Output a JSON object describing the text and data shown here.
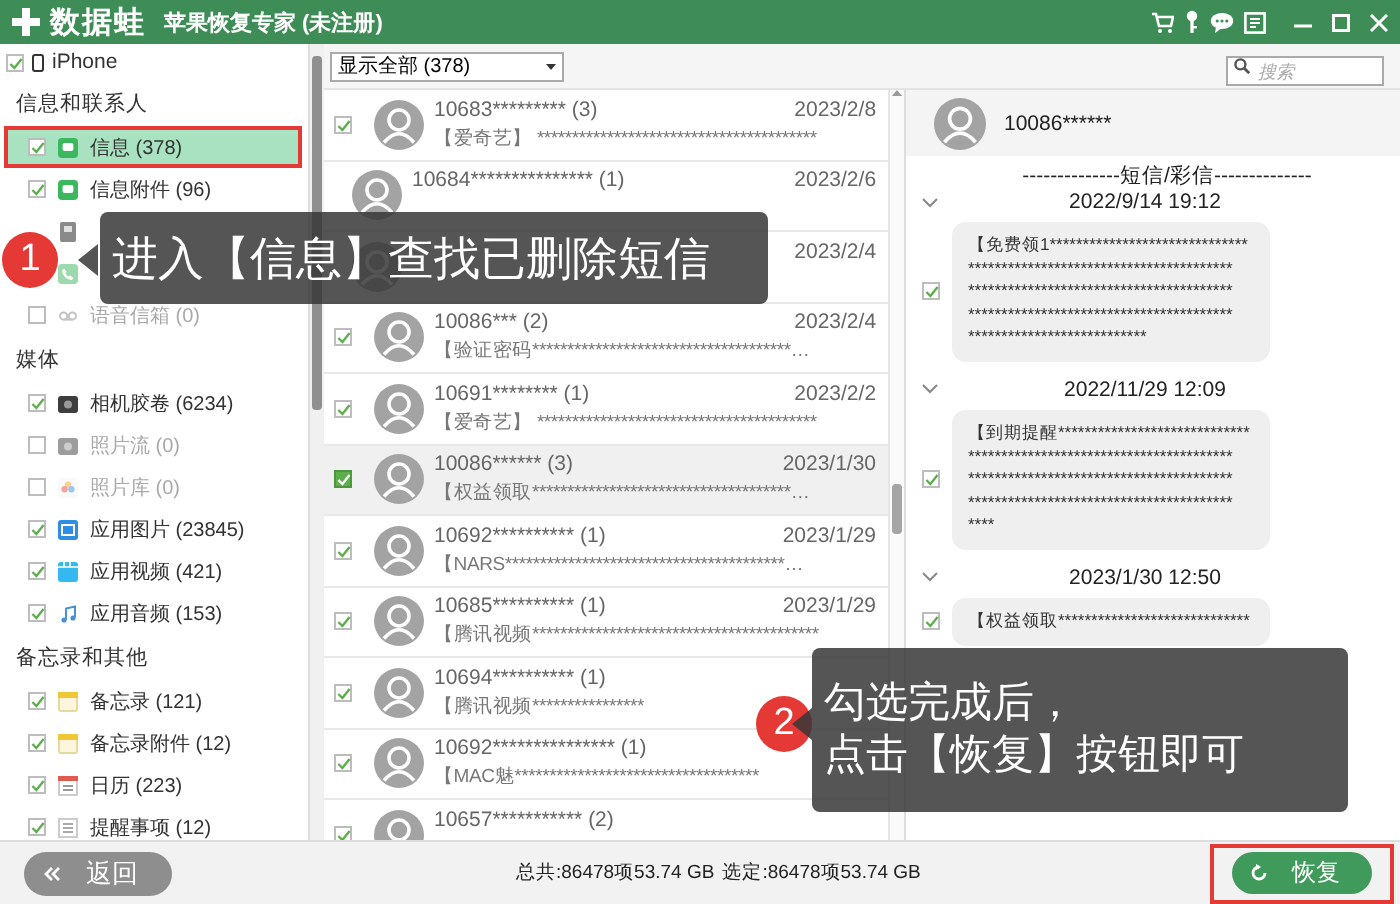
{
  "titlebar": {
    "logo": "数据蛙",
    "title": "苹果恢复专家 (未注册)"
  },
  "device": {
    "name": "iPhone",
    "checked": true
  },
  "sidebar": {
    "groups": [
      {
        "title": "信息和联系人",
        "items": [
          {
            "kind": "chat",
            "label": "信息 (378)",
            "checked": true,
            "disabled": false,
            "selected": true,
            "highlighted": true
          },
          {
            "kind": "chat",
            "label": "信息附件 (96)",
            "checked": true,
            "disabled": false,
            "selected": false,
            "highlighted": false
          },
          {
            "kind": "contacts",
            "disabled": false,
            "selected": false,
            "highlighted": false
          },
          {
            "kind": "phone",
            "disabled": true,
            "selected": false,
            "highlighted": false
          },
          {
            "kind": "voicemail",
            "label": "语音信箱 (0)",
            "checked": false,
            "disabled": true,
            "selected": false,
            "highlighted": false
          }
        ]
      },
      {
        "title": "媒体",
        "items": [
          {
            "kind": "camera",
            "label": "相机胶卷 (6234)",
            "checked": true,
            "disabled": false,
            "selected": false,
            "highlighted": false
          },
          {
            "kind": "camera",
            "label": "照片流 (0)",
            "checked": false,
            "disabled": true,
            "selected": false,
            "highlighted": false
          },
          {
            "kind": "flower",
            "label": "照片库 (0)",
            "checked": false,
            "disabled": true,
            "selected": false,
            "highlighted": false
          },
          {
            "kind": "image",
            "label": "应用图片 (23845)",
            "checked": true,
            "disabled": false,
            "selected": false,
            "highlighted": false
          },
          {
            "kind": "video",
            "label": "应用视频 (421)",
            "checked": true,
            "disabled": false,
            "selected": false,
            "highlighted": false
          },
          {
            "kind": "audio",
            "label": "应用音频 (153)",
            "checked": true,
            "disabled": false,
            "selected": false,
            "highlighted": false
          }
        ]
      },
      {
        "title": "备忘录和其他",
        "items": [
          {
            "kind": "note",
            "label": "备忘录 (121)",
            "checked": true,
            "disabled": false,
            "selected": false,
            "highlighted": false
          },
          {
            "kind": "note",
            "label": "备忘录附件 (12)",
            "checked": true,
            "disabled": false,
            "selected": false,
            "highlighted": false
          },
          {
            "kind": "calendar",
            "label": "日历 (223)",
            "checked": true,
            "disabled": false,
            "selected": false,
            "highlighted": false
          },
          {
            "kind": "list",
            "label": "提醒事项 (12)",
            "checked": true,
            "disabled": false,
            "selected": false,
            "highlighted": false
          }
        ]
      }
    ]
  },
  "toolbar": {
    "filter": "显示全部 (378)",
    "search": {
      "placeholder": "搜索"
    }
  },
  "messages": {
    "rows": [
      {
        "name": "10683********* (3)",
        "date": "2023/2/8",
        "preview": "【爱奇艺】 ****************************************",
        "checked": true,
        "selected": false
      },
      {
        "name": "10684*************** (1)",
        "date": "2023/2/6",
        "selected": false
      },
      {
        "date": "2023/2/4",
        "selected": false
      },
      {
        "name": "10086*** (2)",
        "date": "2023/2/4",
        "preview": "【验证密码*************************************…",
        "checked": true,
        "selected": false
      },
      {
        "name": "10691******** (1)",
        "date": "2023/2/2",
        "preview": "【爱奇艺】 ****************************************",
        "checked": true,
        "selected": false
      },
      {
        "name": "10086****** (3)",
        "date": "2023/1/30",
        "preview": "【权益领取*************************************…",
        "checked": true,
        "selected": true
      },
      {
        "name": "10692********** (1)",
        "date": "2023/1/29",
        "preview": "【NARS****************************************…",
        "checked": true,
        "selected": false
      },
      {
        "name": "10685********** (1)",
        "date": "2023/1/29",
        "preview": "【腾讯视频*****************************************",
        "checked": true,
        "selected": false
      },
      {
        "name": "10694********** (1)",
        "preview": "【腾讯视频****************",
        "checked": true,
        "selected": false
      },
      {
        "name": "10692*************** (1)",
        "preview": "【MAC魅***********************************",
        "checked": true,
        "selected": false
      },
      {
        "name": "10657*********** (2)",
        "checked": true,
        "selected": false
      }
    ]
  },
  "chat": {
    "contact": "10086******",
    "divider": "--------------短信/彩信--------------",
    "messages": [
      {
        "time": "2022/9/14 19:12",
        "expanded": true,
        "checked": true,
        "lines": [
          "【免费领1******************************",
          "****************************************",
          "****************************************",
          "****************************************",
          "***************************"
        ]
      },
      {
        "time": "2022/11/29 12:09",
        "expanded": true,
        "checked": true,
        "lines": [
          "【到期提醒*****************************",
          "****************************************",
          "****************************************",
          "****************************************",
          "****"
        ]
      },
      {
        "time": "2023/1/30 12:50",
        "expanded": true,
        "checked": true,
        "lines": [
          "【权益领取*****************************"
        ]
      }
    ]
  },
  "footer": {
    "back": "返回",
    "total": "总共:86478项53.74 GB",
    "selected_total": "选定:86478项53.74 GB",
    "restore": {
      "label": "恢复",
      "highlighted": true
    }
  },
  "callouts": [
    {
      "number": "1",
      "lines": [
        "进入【信息】查找已删除短信"
      ]
    },
    {
      "number": "2",
      "lines": [
        "勾选完成后，",
        "点击【恢复】按钮即可"
      ]
    }
  ]
}
